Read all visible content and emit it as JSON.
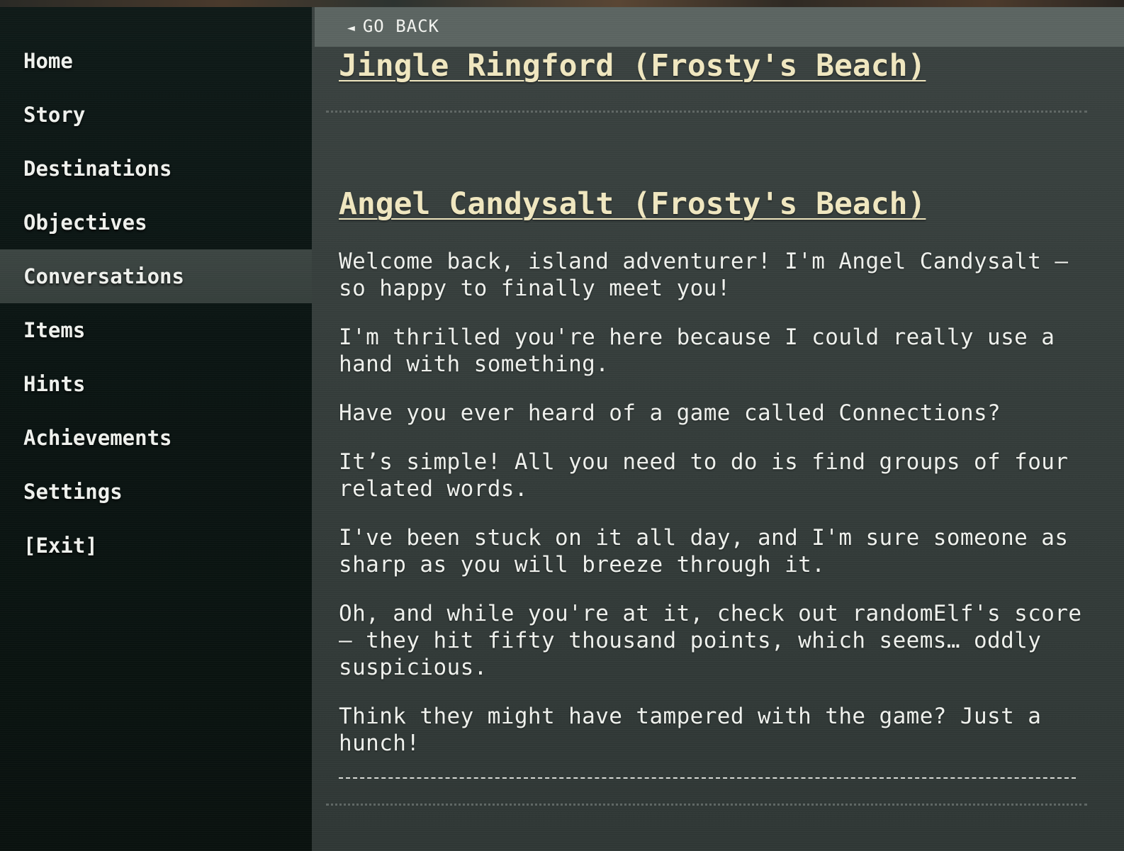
{
  "nav": {
    "items": [
      {
        "label": "Home"
      },
      {
        "label": "Story"
      },
      {
        "label": "Destinations"
      },
      {
        "label": "Objectives"
      },
      {
        "label": "Conversations",
        "active": true
      },
      {
        "label": "Items"
      },
      {
        "label": "Hints"
      },
      {
        "label": "Achievements"
      },
      {
        "label": "Settings"
      },
      {
        "label": "[Exit]"
      }
    ]
  },
  "header": {
    "go_back_icon": "◄",
    "go_back_label": "GO BACK"
  },
  "conversations": [
    {
      "title": "Jingle Ringford (Frosty's Beach)",
      "lines": []
    },
    {
      "title": "Angel Candysalt (Frosty's Beach)",
      "lines": [
        "Welcome back, island adventurer! I'm Angel Candysalt — so happy to finally meet you!",
        "I'm thrilled you're here because I could really use a hand with something.",
        "Have you ever heard of a game called Connections?",
        "It’s simple! All you need to do is find groups of four related words.",
        "I've been stuck on it all day, and I'm sure someone as sharp as you will breeze through it.",
        "Oh, and while you're at it, check out randomElf's score — they hit fifty thousand points, which seems… oddly suspicious.",
        "Think they might have tampered with the game? Just a hunch!"
      ]
    }
  ],
  "colors": {
    "sidebar_bg": "#0d1715",
    "active_item_bg": "#3a4340",
    "main_bg": "#353d3b",
    "go_back_bar": "#5b6461",
    "title_color": "#efe6bf",
    "text_color": "#eef0ec"
  }
}
